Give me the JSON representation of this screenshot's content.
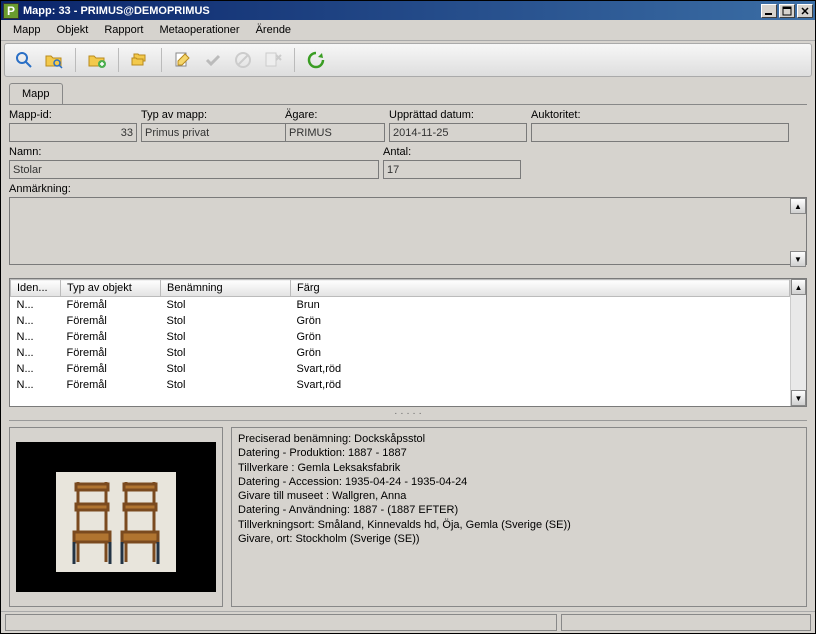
{
  "window": {
    "title": "Mapp: 33 - PRIMUS@DEMOPRIMUS",
    "app_icon_letter": "P"
  },
  "menubar": [
    "Mapp",
    "Objekt",
    "Rapport",
    "Metaoperationer",
    "Ärende"
  ],
  "tab_label": "Mapp",
  "form": {
    "mapp_id": {
      "label": "Mapp-id:",
      "value": "33"
    },
    "typ_av_mapp": {
      "label": "Typ av mapp:",
      "value": "Primus privat"
    },
    "agare": {
      "label": "Ägare:",
      "value": "PRIMUS"
    },
    "upprattad_datum": {
      "label": "Upprättad datum:",
      "value": "2014-11-25"
    },
    "auktoritet": {
      "label": "Auktoritet:",
      "value": ""
    },
    "namn": {
      "label": "Namn:",
      "value": "Stolar"
    },
    "antal": {
      "label": "Antal:",
      "value": "17"
    },
    "anmarkning": {
      "label": "Anmärkning:",
      "value": ""
    }
  },
  "table": {
    "headers": [
      "Iden...",
      "Typ av objekt",
      "Benämning",
      "Färg"
    ],
    "rows": [
      [
        "N...",
        "Föremål",
        "Stol",
        "Brun"
      ],
      [
        "N...",
        "Föremål",
        "Stol",
        "Grön"
      ],
      [
        "N...",
        "Föremål",
        "Stol",
        "Grön"
      ],
      [
        "N...",
        "Föremål",
        "Stol",
        "Grön"
      ],
      [
        "N...",
        "Föremål",
        "Stol",
        "Svart,röd"
      ],
      [
        "N...",
        "Föremål",
        "Stol",
        "Svart,röd"
      ]
    ]
  },
  "details": [
    "Preciserad benämning: Dockskåpsstol",
    "Datering - Produktion: 1887 - 1887",
    "Tillverkare : Gemla Leksaksfabrik",
    "Datering - Accession: 1935-04-24 - 1935-04-24",
    "Givare till museet : Wallgren, Anna",
    "Datering - Användning: 1887 -   (1887 EFTER)",
    "Tillverkningsort: Småland, Kinnevalds hd, Öja, Gemla (Sverige (SE))",
    "Givare, ort: Stockholm (Sverige (SE))"
  ],
  "toolbar_icons": [
    "search-icon",
    "folder-search-icon",
    "sep",
    "folder-plus-icon",
    "sep",
    "folder-copy-icon",
    "sep",
    "edit-icon",
    "check-gray-icon",
    "cancel-gray-icon",
    "delete-gray-icon",
    "sep",
    "refresh-icon"
  ]
}
